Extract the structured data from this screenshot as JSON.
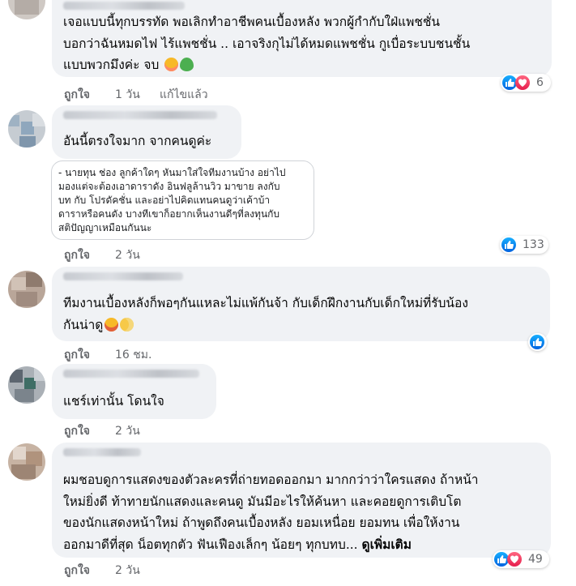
{
  "comments": [
    {
      "lines": [
        "เจอแบบนี้ทุกบรรทัด พอเลิกทำอาชีพคนเบื้องหลัง พวกผู้กำกับใฝ่แพชชั่น",
        "บอกว่าฉันหมดไฟ ไร้แพชชั่น .. เอาจริงกุไม่ได้หมดแพชชั่น กูเบื่อระบบชนชั้น",
        "แบบพวกมึงค่ะ จบ"
      ],
      "like": "ถูกใจ",
      "time": "1 วัน",
      "edited": "แก้ไขแล้ว",
      "reactions": "6"
    },
    {
      "lines": [
        "อันนี้ตรงใจมาก จากคนดูค่ะ"
      ],
      "quote": [
        "- นายทุน ช่อง ลูกค้าใดๆ หันมาใส่ใจทีมงานบ้าง อย่าไป",
        "มองแต่จะต้องเอาดาราดัง อินฟลูล้านวิว มาขาย ลงกับ",
        "บท กับ โปรดัคชั่น และอย่าไปคิดแทนคนดูว่าเค้าบ้า",
        "ดาราหรือคนดัง บางทีเขาก็อยากเห็นงานดีๆที่ลงทุนกับ",
        "สติปัญญาเหมือนกันนะ"
      ],
      "reactions": "133",
      "like": "ถูกใจ",
      "time": "2 วัน"
    },
    {
      "lines": [
        "ทีมงานเบื้องหลังก็พอๆกันแหละไม่แพ้กันจ้า กับเด็กฝึกงานกับเด็กใหม่ที่รับน้อง",
        "กันน่าดู"
      ],
      "like": "ถูกใจ",
      "time": "16 ชม."
    },
    {
      "lines": [
        "แชร์เท่านั้น โดนใจ"
      ],
      "like": "ถูกใจ",
      "time": "2 วัน"
    },
    {
      "lines": [
        "ผมชอบดูการแสดงของตัวละครที่ถ่ายทอดออกมา มากกว่าว่าใครแสดง ถ้าหน้า",
        "ใหม่ยิ่งดี ท้าทายนักแสดงและคนดู มันมีอะไรให้ค้นหา และคอยดูการเติบโต",
        "ของนักแสดงหน้าใหม่ ถ้าพูดถึงคนเบื้องหลัง ยอมเหนื่อย ยอมทน เพื่อให้งาน",
        "ออกมาดีที่สุด น็อตทุกตัว ฟันเฟืองเล็กๆ น้อยๆ ทุกบทบ..."
      ],
      "see_more": "ดูเพิ่มเติม",
      "reactions": "49",
      "like": "ถูกใจ",
      "time": "2 วัน"
    }
  ],
  "colors": {
    "bubble": "#f0f2f5",
    "like_blue": "#0866ff",
    "love_red": "#f33e58",
    "meta_gray": "#65676b"
  }
}
